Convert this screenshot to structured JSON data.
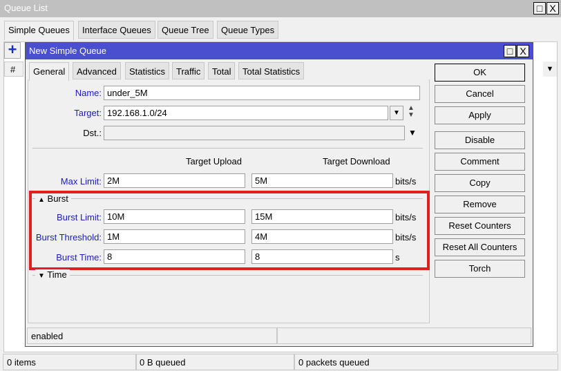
{
  "window": {
    "title": "Queue List"
  },
  "tabs": [
    "Simple Queues",
    "Interface Queues",
    "Queue Tree",
    "Queue Types"
  ],
  "list": {
    "col_hash": "#",
    "add_icon": "plus-icon"
  },
  "dialog": {
    "title": "New Simple Queue",
    "tabs": [
      "General",
      "Advanced",
      "Statistics",
      "Traffic",
      "Total",
      "Total Statistics"
    ],
    "name_label": "Name:",
    "name": "under_5M",
    "target_label": "Target:",
    "target": "192.168.1.0/24",
    "dst_label": "Dst.:",
    "dst": "",
    "col_upload": "Target Upload",
    "col_download": "Target Download",
    "max_limit_label": "Max Limit:",
    "max_upload": "2M",
    "max_download": "5M",
    "bits": "bits/s",
    "burst_section": "Burst",
    "burst_limit_label": "Burst Limit:",
    "burst_limit_up": "10M",
    "burst_limit_down": "15M",
    "burst_threshold_label": "Burst Threshold:",
    "burst_threshold_up": "1M",
    "burst_threshold_down": "4M",
    "burst_time_label": "Burst Time:",
    "burst_time_up": "8",
    "burst_time_down": "8",
    "seconds": "s",
    "time_section": "Time",
    "status": "enabled",
    "buttons": [
      "OK",
      "Cancel",
      "Apply",
      "Disable",
      "Comment",
      "Copy",
      "Remove",
      "Reset Counters",
      "Reset All Counters",
      "Torch"
    ],
    "highlight_color": "#e02020"
  },
  "statusbar": {
    "items": "0 items",
    "queued": "0 B queued",
    "packets": "0 packets queued"
  }
}
